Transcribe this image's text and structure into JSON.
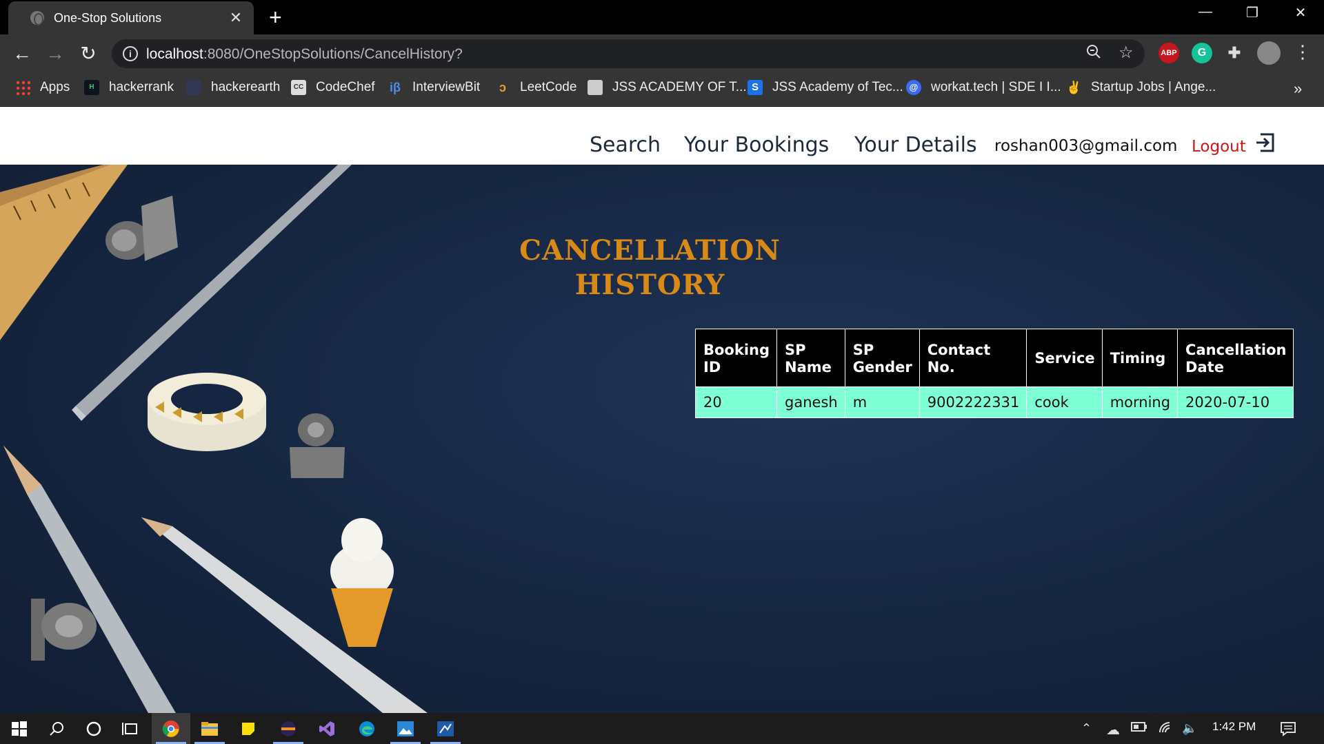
{
  "browser": {
    "tab_title": "One-Stop Solutions",
    "tab_close": "✕",
    "new_tab": "+",
    "url_host": "localhost",
    "url_rest": ":8080/OneStopSolutions/CancelHistory?",
    "extensions": {
      "abp": "ABP",
      "grammarly": "G"
    }
  },
  "bookmarks": [
    {
      "label": "Apps",
      "icon": "apps-grid-icon"
    },
    {
      "label": "hackerrank",
      "icon": "hackerrank-icon"
    },
    {
      "label": "hackerearth",
      "icon": "hackerearth-icon"
    },
    {
      "label": "CodeChef",
      "icon": "codechef-icon"
    },
    {
      "label": "InterviewBit",
      "icon": "interviewbit-icon"
    },
    {
      "label": "LeetCode",
      "icon": "leetcode-icon"
    },
    {
      "label": "JSS ACADEMY OF T...",
      "icon": "jss-icon"
    },
    {
      "label": "JSS Academy of Tec...",
      "icon": "jss-s-icon"
    },
    {
      "label": "workat.tech | SDE I I...",
      "icon": "workat-icon"
    },
    {
      "label": "Startup Jobs | Ange...",
      "icon": "angellist-icon"
    }
  ],
  "nav": {
    "search": "Search",
    "bookings": "Your Bookings",
    "details": "Your Details",
    "email": "roshan003@gmail.com",
    "logout": "Logout"
  },
  "page": {
    "heading_line1": "CANCELLATION",
    "heading_line2": "HISTORY",
    "accent_color": "#d98a16",
    "row_color": "#7fffd4"
  },
  "table": {
    "headers": [
      [
        "Booking",
        "ID"
      ],
      [
        "SP",
        "Name"
      ],
      [
        "SP",
        "Gender"
      ],
      [
        "Contact",
        "No."
      ],
      [
        "Service",
        ""
      ],
      [
        "Timing",
        ""
      ],
      [
        "Cancellation",
        "Date"
      ]
    ],
    "rows": [
      [
        "20",
        "ganesh",
        "m",
        "9002222331",
        "cook",
        "morning",
        "2020-07-10"
      ]
    ]
  },
  "taskbar": {
    "time": "1:42 PM"
  }
}
